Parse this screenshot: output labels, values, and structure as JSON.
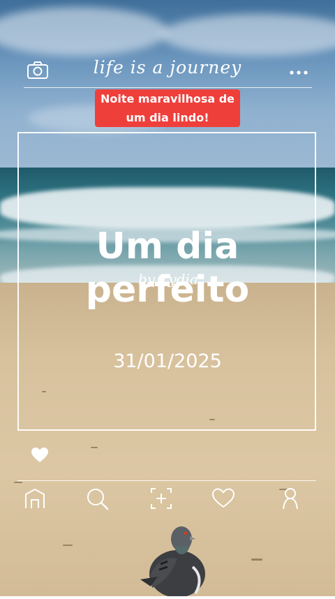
{
  "header": {
    "logo": "life is a journey"
  },
  "caption": "Noite maravilhosa de\num dia lindo!",
  "post": {
    "title_line1": "Um dia",
    "title_line2": "perfeito",
    "signature": "by Lydia",
    "date": "31/01/2025"
  },
  "icons": {
    "camera": "camera-icon",
    "more": "more-dots-icon",
    "like": "heart-icon",
    "nav": [
      "home-icon",
      "search-icon",
      "add-post-icon",
      "heart-icon",
      "profile-icon"
    ]
  },
  "colors": {
    "caption_bg": "#ef3f3b",
    "overlay": "#ffffff"
  }
}
